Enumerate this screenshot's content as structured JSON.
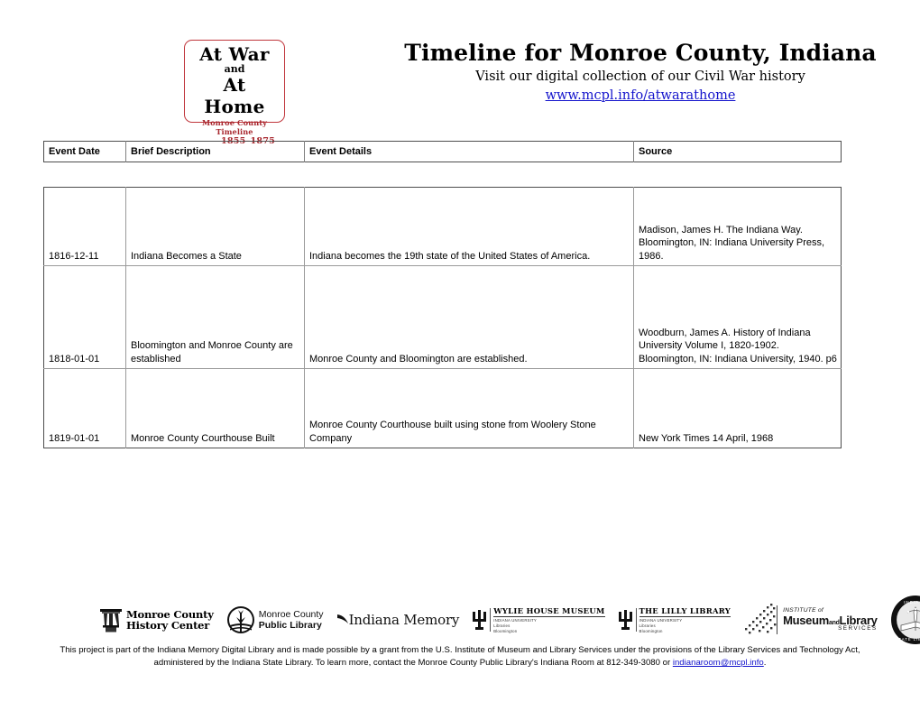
{
  "header": {
    "logo": {
      "line1": "At War",
      "conjunction": "and",
      "line2": "At Home",
      "subtitle": "Monroe County Timeline",
      "years": "1855–1875",
      "border_color": "#c0363c",
      "text_color": "#a8282f"
    },
    "title": "Timeline for Monroe County, Indiana",
    "subtitle": "Visit our digital collection of our Civil War history",
    "link_text": "www.mcpl.info/atwarathome",
    "link_color": "#1414cc"
  },
  "table": {
    "columns": [
      "Event Date",
      "Brief Description",
      "Event Details",
      "Source"
    ],
    "rows": [
      {
        "date": "1816-12-11",
        "brief": "Indiana Becomes a State",
        "details": "Indiana becomes the 19th state of the United States of America.",
        "source": "Madison, James H. The Indiana Way. Bloomington, IN: Indiana University Press, 1986."
      },
      {
        "date": "1818-01-01",
        "brief": "Bloomington and Monroe County are established",
        "details": "Monroe County and Bloomington are established.",
        "source": "Woodburn, James A. History of Indiana University Volume I, 1820-1902. Bloomington, IN: Indiana University, 1940. p6"
      },
      {
        "date": "1819-01-01",
        "brief": "Monroe County Courthouse Built",
        "details": "Monroe County Courthouse built using stone from Woolery Stone Company",
        "source": "New York Times 14 April, 1968"
      }
    ]
  },
  "footer": {
    "logos": [
      {
        "id": "monroe-county-history-center",
        "line1": "Monroe County",
        "line2": "History Center"
      },
      {
        "id": "monroe-county-public-library",
        "line1": "Monroe County",
        "line2": "Public Library"
      },
      {
        "id": "indiana-memory",
        "line1": "Indiana Memory"
      },
      {
        "id": "wylie-house-museum",
        "main": "WYLIE HOUSE MUSEUM",
        "sub1": "INDIANA UNIVERSITY",
        "sub2": "Libraries",
        "sub3": "Bloomington"
      },
      {
        "id": "the-lilly-library",
        "main": "THE LILLY LIBRARY",
        "sub1": "INDIANA UNIVERSITY",
        "sub2": "Libraries",
        "sub3": "Bloomington"
      },
      {
        "id": "institute-of-museum-and-library-services",
        "line1": "INSTITUTE of",
        "line2a": "Museum",
        "line2b": "and",
        "line2c": "Library",
        "line3": "SERVICES"
      },
      {
        "id": "indiana-state-library",
        "top": "INDIANA",
        "bottom": "STATE LIBRARY"
      }
    ],
    "text_part1": "This project is part of the Indiana Memory Digital Library and is made possible by a grant from the U.S. Institute of Museum and Library Services under the provisions of the Library Services and Technology Act, administered by the Indiana State Library. To learn more, contact the Monroe County Public Library's Indiana Room at 812-349-3080 or ",
    "email": "indianaroom@mcpl.info",
    "text_part2": "."
  }
}
